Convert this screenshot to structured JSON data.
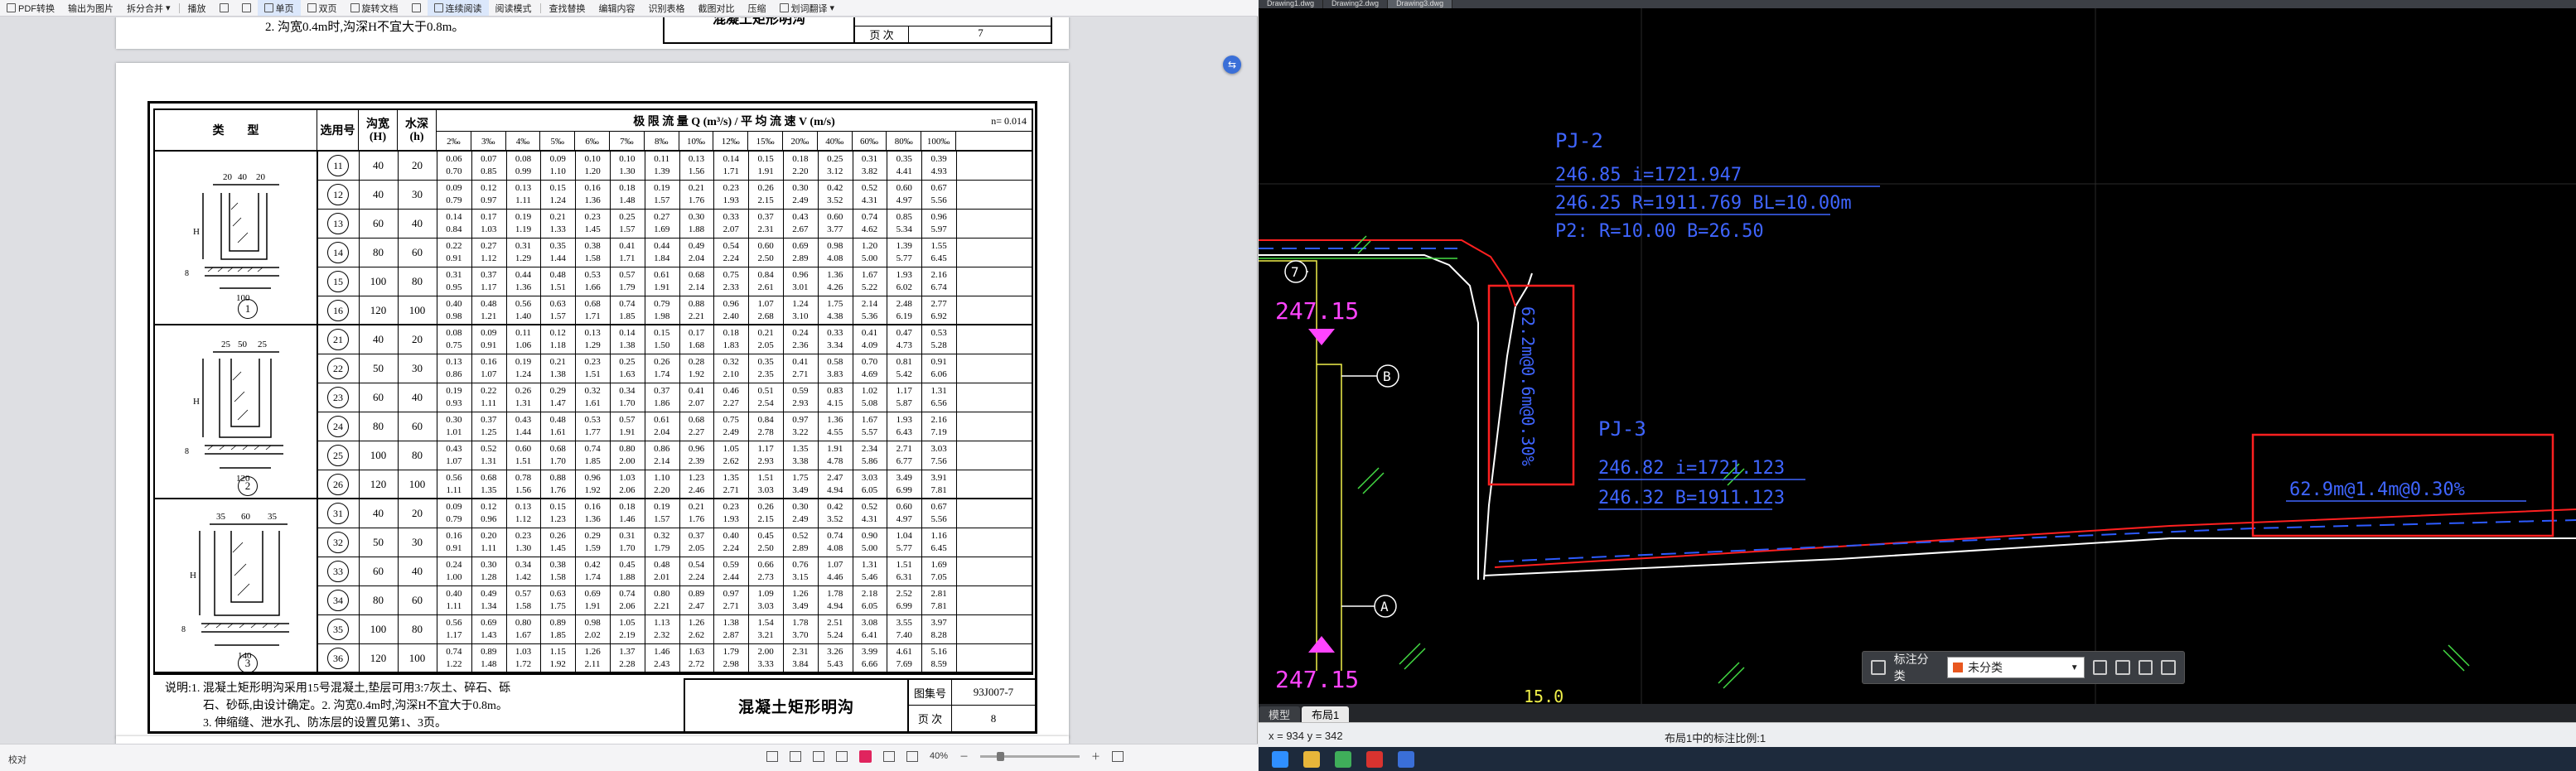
{
  "pdf": {
    "toolbar": [
      "PDF转换",
      "输出为图片",
      "拆分合并",
      "播放",
      "单页",
      "双页",
      "旋转文档",
      "连续阅读",
      "阅读模式",
      "查找替换",
      "编辑内容",
      "识别表格",
      "截图对比",
      "压缩",
      "划词翻译"
    ],
    "prev_page": {
      "note": "2. 沟宽0.4m时,沟深H不宜大于0.8m。",
      "title": "混凝土矩形明沟",
      "page_label": "页 次",
      "page_value": "7"
    },
    "table": {
      "header_type": "类　　型",
      "header_code": "选用号",
      "header_width": "沟宽 (H)",
      "header_depth": "水深 (h)",
      "header_main": "极 限 流 量 Q (m³/s) / 平 均 流 速 V (m/s)",
      "n_value": "n= 0.014",
      "slopes": [
        "2‰",
        "3‰",
        "4‰",
        "5‰",
        "6‰",
        "7‰",
        "8‰",
        "10‰",
        "12‰",
        "15‰",
        "20‰",
        "40‰",
        "60‰",
        "80‰",
        "100‰"
      ],
      "type_labels": [
        "1",
        "2",
        "3"
      ],
      "dims1": [
        "20",
        "40",
        "20",
        "100",
        "8"
      ],
      "dims2": [
        "25",
        "50",
        "25",
        "120",
        "8"
      ],
      "dims3": [
        "35",
        "60",
        "35",
        "140",
        "8"
      ],
      "rows": [
        {
          "code": "11",
          "w": "40",
          "h": "20",
          "q": [
            "0.06",
            "0.07",
            "0.08",
            "0.09",
            "0.10",
            "0.10",
            "0.11",
            "0.13",
            "0.14",
            "0.15",
            "0.18",
            "0.25",
            "0.31",
            "0.35",
            "0.39"
          ],
          "v": [
            "0.70",
            "0.85",
            "0.99",
            "1.10",
            "1.20",
            "1.30",
            "1.39",
            "1.56",
            "1.71",
            "1.91",
            "2.20",
            "3.12",
            "3.82",
            "4.41",
            "4.93"
          ]
        },
        {
          "code": "12",
          "w": "40",
          "h": "30",
          "q": [
            "0.09",
            "0.12",
            "0.13",
            "0.15",
            "0.16",
            "0.18",
            "0.19",
            "0.21",
            "0.23",
            "0.26",
            "0.30",
            "0.42",
            "0.52",
            "0.60",
            "0.67"
          ],
          "v": [
            "0.79",
            "0.97",
            "1.11",
            "1.24",
            "1.36",
            "1.48",
            "1.57",
            "1.76",
            "1.93",
            "2.15",
            "2.49",
            "3.52",
            "4.31",
            "4.97",
            "5.56"
          ]
        },
        {
          "code": "13",
          "w": "60",
          "h": "40",
          "q": [
            "0.14",
            "0.17",
            "0.19",
            "0.21",
            "0.23",
            "0.25",
            "0.27",
            "0.30",
            "0.33",
            "0.37",
            "0.43",
            "0.60",
            "0.74",
            "0.85",
            "0.96"
          ],
          "v": [
            "0.84",
            "1.03",
            "1.19",
            "1.33",
            "1.45",
            "1.57",
            "1.69",
            "1.88",
            "2.07",
            "2.31",
            "2.67",
            "3.77",
            "4.62",
            "5.34",
            "5.97"
          ]
        },
        {
          "code": "14",
          "w": "80",
          "h": "60",
          "q": [
            "0.22",
            "0.27",
            "0.31",
            "0.35",
            "0.38",
            "0.41",
            "0.44",
            "0.49",
            "0.54",
            "0.60",
            "0.69",
            "0.98",
            "1.20",
            "1.39",
            "1.55"
          ],
          "v": [
            "0.91",
            "1.12",
            "1.29",
            "1.44",
            "1.58",
            "1.71",
            "1.84",
            "2.04",
            "2.24",
            "2.50",
            "2.89",
            "4.08",
            "5.00",
            "5.77",
            "6.45"
          ]
        },
        {
          "code": "15",
          "w": "100",
          "h": "80",
          "q": [
            "0.31",
            "0.37",
            "0.44",
            "0.48",
            "0.53",
            "0.57",
            "0.61",
            "0.68",
            "0.75",
            "0.84",
            "0.96",
            "1.36",
            "1.67",
            "1.93",
            "2.16"
          ],
          "v": [
            "0.95",
            "1.17",
            "1.36",
            "1.51",
            "1.66",
            "1.79",
            "1.91",
            "2.14",
            "2.33",
            "2.61",
            "3.01",
            "4.26",
            "5.22",
            "6.02",
            "6.74"
          ]
        },
        {
          "code": "16",
          "w": "120",
          "h": "100",
          "q": [
            "0.40",
            "0.48",
            "0.56",
            "0.63",
            "0.68",
            "0.74",
            "0.79",
            "0.88",
            "0.96",
            "1.07",
            "1.24",
            "1.75",
            "2.14",
            "2.48",
            "2.77"
          ],
          "v": [
            "0.98",
            "1.21",
            "1.40",
            "1.57",
            "1.71",
            "1.85",
            "1.98",
            "2.21",
            "2.40",
            "2.68",
            "3.10",
            "4.38",
            "5.36",
            "6.19",
            "6.92"
          ]
        },
        {
          "code": "21",
          "w": "40",
          "h": "20",
          "q": [
            "0.08",
            "0.09",
            "0.11",
            "0.12",
            "0.13",
            "0.14",
            "0.15",
            "0.17",
            "0.18",
            "0.21",
            "0.24",
            "0.33",
            "0.41",
            "0.47",
            "0.53"
          ],
          "v": [
            "0.75",
            "0.91",
            "1.06",
            "1.18",
            "1.29",
            "1.38",
            "1.50",
            "1.68",
            "1.83",
            "2.05",
            "2.36",
            "3.34",
            "4.09",
            "4.73",
            "5.28"
          ]
        },
        {
          "code": "22",
          "w": "50",
          "h": "30",
          "q": [
            "0.13",
            "0.16",
            "0.19",
            "0.21",
            "0.23",
            "0.25",
            "0.26",
            "0.28",
            "0.32",
            "0.35",
            "0.41",
            "0.58",
            "0.70",
            "0.81",
            "0.91"
          ],
          "v": [
            "0.86",
            "1.07",
            "1.24",
            "1.38",
            "1.51",
            "1.63",
            "1.74",
            "1.92",
            "2.10",
            "2.35",
            "2.71",
            "3.83",
            "4.69",
            "5.42",
            "6.06"
          ]
        },
        {
          "code": "23",
          "w": "60",
          "h": "40",
          "q": [
            "0.19",
            "0.22",
            "0.26",
            "0.29",
            "0.32",
            "0.34",
            "0.37",
            "0.41",
            "0.46",
            "0.51",
            "0.59",
            "0.83",
            "1.02",
            "1.17",
            "1.31"
          ],
          "v": [
            "0.93",
            "1.11",
            "1.31",
            "1.47",
            "1.61",
            "1.70",
            "1.86",
            "2.07",
            "2.27",
            "2.54",
            "2.93",
            "4.15",
            "5.08",
            "5.87",
            "6.56"
          ]
        },
        {
          "code": "24",
          "w": "80",
          "h": "60",
          "q": [
            "0.30",
            "0.37",
            "0.43",
            "0.48",
            "0.53",
            "0.57",
            "0.61",
            "0.68",
            "0.75",
            "0.84",
            "0.97",
            "1.36",
            "1.67",
            "1.93",
            "2.16"
          ],
          "v": [
            "1.01",
            "1.25",
            "1.44",
            "1.61",
            "1.77",
            "1.91",
            "2.04",
            "2.27",
            "2.49",
            "2.78",
            "3.22",
            "4.55",
            "5.57",
            "6.43",
            "7.19"
          ]
        },
        {
          "code": "25",
          "w": "100",
          "h": "80",
          "q": [
            "0.43",
            "0.52",
            "0.60",
            "0.68",
            "0.74",
            "0.80",
            "0.86",
            "0.96",
            "1.05",
            "1.17",
            "1.35",
            "1.91",
            "2.34",
            "2.71",
            "3.03"
          ],
          "v": [
            "1.07",
            "1.31",
            "1.51",
            "1.70",
            "1.85",
            "2.00",
            "2.14",
            "2.39",
            "2.62",
            "2.93",
            "3.38",
            "4.78",
            "5.86",
            "6.77",
            "7.56"
          ]
        },
        {
          "code": "26",
          "w": "120",
          "h": "100",
          "q": [
            "0.56",
            "0.68",
            "0.78",
            "0.88",
            "0.96",
            "1.03",
            "1.10",
            "1.23",
            "1.35",
            "1.51",
            "1.75",
            "2.47",
            "3.03",
            "3.49",
            "3.91"
          ],
          "v": [
            "1.11",
            "1.35",
            "1.56",
            "1.76",
            "1.92",
            "2.06",
            "2.20",
            "2.46",
            "2.71",
            "3.03",
            "3.49",
            "4.94",
            "6.05",
            "6.99",
            "7.81"
          ]
        },
        {
          "code": "31",
          "w": "40",
          "h": "20",
          "q": [
            "0.09",
            "0.12",
            "0.13",
            "0.15",
            "0.16",
            "0.18",
            "0.19",
            "0.21",
            "0.23",
            "0.26",
            "0.30",
            "0.42",
            "0.52",
            "0.60",
            "0.67"
          ],
          "v": [
            "0.79",
            "0.96",
            "1.12",
            "1.23",
            "1.36",
            "1.46",
            "1.57",
            "1.76",
            "1.93",
            "2.15",
            "2.49",
            "3.52",
            "4.31",
            "4.97",
            "5.56"
          ]
        },
        {
          "code": "32",
          "w": "50",
          "h": "30",
          "q": [
            "0.16",
            "0.20",
            "0.23",
            "0.26",
            "0.29",
            "0.31",
            "0.32",
            "0.37",
            "0.40",
            "0.45",
            "0.52",
            "0.74",
            "0.90",
            "1.04",
            "1.16"
          ],
          "v": [
            "0.91",
            "1.11",
            "1.30",
            "1.45",
            "1.59",
            "1.70",
            "1.79",
            "2.05",
            "2.24",
            "2.50",
            "2.89",
            "4.08",
            "5.00",
            "5.77",
            "6.45"
          ]
        },
        {
          "code": "33",
          "w": "60",
          "h": "40",
          "q": [
            "0.24",
            "0.30",
            "0.34",
            "0.38",
            "0.42",
            "0.45",
            "0.48",
            "0.54",
            "0.59",
            "0.66",
            "0.76",
            "1.07",
            "1.31",
            "1.51",
            "1.69"
          ],
          "v": [
            "1.00",
            "1.28",
            "1.42",
            "1.58",
            "1.74",
            "1.88",
            "2.01",
            "2.24",
            "2.44",
            "2.73",
            "3.15",
            "4.46",
            "5.46",
            "6.31",
            "7.05"
          ]
        },
        {
          "code": "34",
          "w": "80",
          "h": "60",
          "q": [
            "0.40",
            "0.49",
            "0.57",
            "0.63",
            "0.69",
            "0.74",
            "0.80",
            "0.89",
            "0.97",
            "1.09",
            "1.26",
            "1.78",
            "2.18",
            "2.52",
            "2.81"
          ],
          "v": [
            "1.11",
            "1.34",
            "1.58",
            "1.75",
            "1.91",
            "2.06",
            "2.21",
            "2.47",
            "2.71",
            "3.03",
            "3.49",
            "4.94",
            "6.05",
            "6.99",
            "7.81"
          ]
        },
        {
          "code": "35",
          "w": "100",
          "h": "80",
          "q": [
            "0.56",
            "0.69",
            "0.80",
            "0.89",
            "0.98",
            "1.05",
            "1.13",
            "1.26",
            "1.38",
            "1.54",
            "1.78",
            "2.51",
            "3.08",
            "3.55",
            "3.97"
          ],
          "v": [
            "1.17",
            "1.43",
            "1.67",
            "1.85",
            "2.02",
            "2.19",
            "2.32",
            "2.62",
            "2.87",
            "3.21",
            "3.70",
            "5.24",
            "6.41",
            "7.40",
            "8.28"
          ]
        },
        {
          "code": "36",
          "w": "120",
          "h": "100",
          "q": [
            "0.74",
            "0.89",
            "1.03",
            "1.15",
            "1.26",
            "1.37",
            "1.46",
            "1.63",
            "1.79",
            "2.00",
            "2.31",
            "3.26",
            "3.99",
            "4.61",
            "5.16"
          ],
          "v": [
            "1.22",
            "1.48",
            "1.72",
            "1.92",
            "2.11",
            "2.28",
            "2.43",
            "2.72",
            "2.98",
            "3.33",
            "3.84",
            "5.43",
            "6.66",
            "7.69",
            "8.59"
          ]
        }
      ]
    },
    "notes": {
      "line1": "说明:1. 混凝土矩形明沟采用15号混凝土,垫层可用3:7灰土、碎石、砾",
      "line2": "石、砂砾,由设计确定。2. 沟宽0.4m时,沟深H不宜大于0.8m。",
      "line3": "3. 伸缩缝、泄水孔、防冻层的设置见第1、3页。"
    },
    "title_block": {
      "title": "混凝土矩形明沟",
      "atlas_label": "图集号",
      "atlas_value": "93J007-7",
      "page_label": "页 次",
      "page_value": "8"
    },
    "float_button": "⇆",
    "status": {
      "left": "校对",
      "zoom": "40%"
    }
  },
  "cad": {
    "tabs": [
      "Drawing1.dwg",
      "Drawing2.dwg",
      "Drawing3.dwg"
    ],
    "labels": {
      "pj2_title": "PJ-2",
      "pj2_l1": "246.85  i=1721.947",
      "pj2_l2": "246.25  R=1911.769   BL=10.00m",
      "pj2_l3": "P2: R=10.00  B=26.50",
      "pj3_title": "PJ-3",
      "pj3_l1": "246.82  i=1721.123",
      "pj3_l2": "246.32  B=1911.123",
      "elev_top": "247.15",
      "elev_bottom": "247.15",
      "box1_text": "62.2m@0.6m@0.30%",
      "box2_text": "62.9m@1.4m@0.30%",
      "axis_7": "7",
      "axis_b": "B",
      "axis_a": "A",
      "bottom_text": "15.0"
    },
    "anno": {
      "label": "标注分类",
      "value": "未分类",
      "swatch_color": "#e8571f"
    },
    "layout_tabs": [
      "模型",
      "布局1"
    ],
    "coord": "x = 934  y = 342",
    "scale_note": "布局1中的标注比例:1",
    "colors": {
      "bg": "#000000",
      "red": "#ff2020",
      "blue": "#2d5bff",
      "magenta": "#ff44ff",
      "yellow": "#f0f04a",
      "green": "#44dd44",
      "white": "#ffffff"
    }
  }
}
